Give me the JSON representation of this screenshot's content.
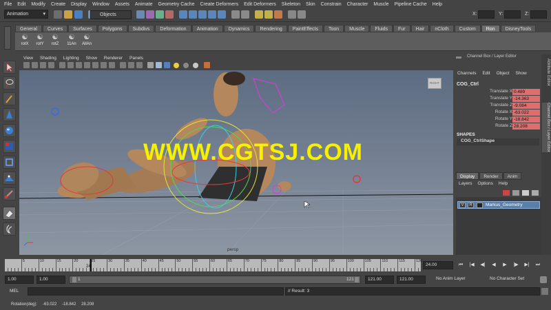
{
  "menus": [
    "File",
    "Edit",
    "Modify",
    "Create",
    "Display",
    "Window",
    "Assets",
    "Animate",
    "Geometry Cache",
    "Create Deformers",
    "Edit Deformers",
    "Skeleton",
    "Skin",
    "Constrain",
    "Character",
    "Muscle",
    "Pipeline Cache",
    "Help"
  ],
  "status": {
    "mode_value": "Animation",
    "selection_value": "Objects",
    "x_label": "X:",
    "y_label": "Y:",
    "z_label": "Z:"
  },
  "shelf": {
    "tabs": [
      "General",
      "Curves",
      "Surfaces",
      "Polygons",
      "Subdivs",
      "Deformation",
      "Animation",
      "Dynamics",
      "Rendering",
      "PaintEffects",
      "Toon",
      "Muscle",
      "Fluids",
      "Fur",
      "Hair",
      "nCloth",
      "Custom",
      "Ron",
      "DisneyTools"
    ],
    "active_tab": "Ron",
    "buttons": [
      "rotX",
      "rotY",
      "rotZ",
      "11An",
      "AllAn"
    ]
  },
  "viewport": {
    "menus": [
      "View",
      "Shading",
      "Lighting",
      "Show",
      "Renderer",
      "Panels"
    ],
    "watermark": "WWW.CGTSJ.COM",
    "camera_label": "persp",
    "viewcube_label": "RIGHT"
  },
  "channel_box": {
    "title": "Channel Box / Layer Editor",
    "menus": [
      "Channels",
      "Edit",
      "Object",
      "Show"
    ],
    "object_name": "COG_Ctrl",
    "channels": [
      {
        "name": "Translate X",
        "value": "0.489"
      },
      {
        "name": "Translate Y",
        "value": "-14.363"
      },
      {
        "name": "Translate Z",
        "value": "-9.084"
      },
      {
        "name": "Rotate X",
        "value": "-63.022"
      },
      {
        "name": "Rotate Y",
        "value": "-18.842"
      },
      {
        "name": "Rotate Z",
        "value": "28.208"
      }
    ],
    "shapes_header": "SHAPES",
    "shape_name": "COG_CtrlShape",
    "side_tabs": [
      "Attribute Editor",
      "Channel Box / Layer Editor"
    ]
  },
  "layer_editor": {
    "tabs": [
      "Display",
      "Render",
      "Anim"
    ],
    "active_tab": "Display",
    "menus": [
      "Layers",
      "Options",
      "Help"
    ],
    "layer": {
      "v": "V",
      "r": "R",
      "name": "Markus_Geometry"
    }
  },
  "timeline": {
    "ticks": [
      "5",
      "10",
      "15",
      "20",
      "25",
      "30",
      "35",
      "40",
      "45",
      "50",
      "55",
      "60",
      "65",
      "70",
      "75",
      "80",
      "85",
      "90",
      "95",
      "100",
      "105",
      "110",
      "115",
      "120"
    ],
    "current_frame_label": "24",
    "current_time": "24.00"
  },
  "range": {
    "start": "1.00",
    "playback_start": "1.00",
    "slider_start": "1",
    "slider_end": "121",
    "playback_end": "121.00",
    "end": "121.00",
    "anim_layer": "No Anim Layer",
    "character_set": "No Character Set"
  },
  "command": {
    "label": "MEL",
    "result": "// Result: 3"
  },
  "help_line": {
    "label": "Rotation(deg):",
    "x": "-63.022",
    "y": "-18.842",
    "z": "28.208"
  },
  "colors": {
    "keyed_channel": "#e06d6d",
    "watermark": "#f7f100",
    "viewport_top": "#5d6c82",
    "viewport_bottom": "#8d96a3",
    "selected_layer": "#5b7fa8"
  }
}
